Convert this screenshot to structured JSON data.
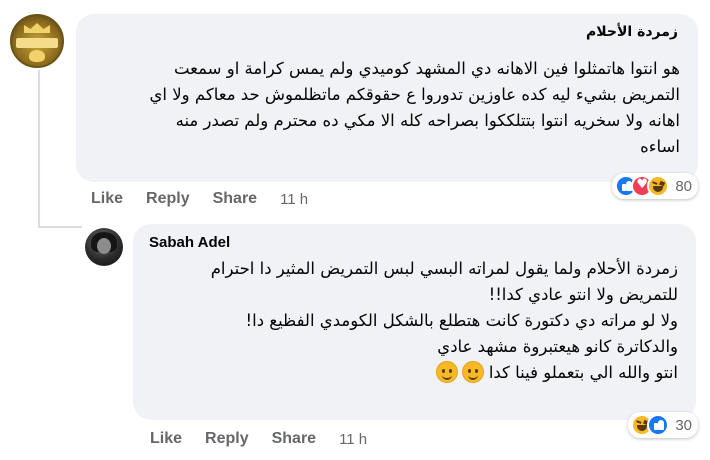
{
  "comments": [
    {
      "author": "زمردة الأحلام",
      "lines": [
        "هو انتوا هاتمثلوا فين الاهانه دي المشهد كوميدي ولم يمس كرامة او سمعت",
        "التمريض بشيء ليه كده عاوزين تدوروا ع حقوقكم ماتظلموش حد معاكم ولا اي",
        "اهانه ولا سخريه انتوا بتتلككوا بصراحه كله الا مكي ده محترم ولم تصدر منه",
        "اساءه"
      ],
      "reaction_icons": [
        "like-icon",
        "love-icon",
        "haha-icon"
      ],
      "reaction_count": "80",
      "actions": {
        "like": "Like",
        "reply": "Reply",
        "share": "Share"
      },
      "time": "11 h"
    },
    {
      "author": "Sabah Adel",
      "lines": [
        "زمردة الأحلام ولما يقول لمراته البسي لبس التمريض المثير دا احترام",
        "للتمريض ولا انتو عادي كدا!!",
        "ولا لو مراته دي دكتورة كانت هتطلع بالشكل الكومدي الفظيع دا!",
        "والدكاترة كانو هيعتبروة مشهد عادي",
        "انتو والله الي بتعملو فينا كدا"
      ],
      "emoji_icons": [
        "smiley-icon",
        "smiley-icon"
      ],
      "reaction_icons": [
        "haha-icon",
        "like-icon"
      ],
      "reaction_count": "30",
      "actions": {
        "like": "Like",
        "reply": "Reply",
        "share": "Share"
      },
      "time": "11 h"
    }
  ],
  "colors": {
    "bubble": "#f0f2f5",
    "secondary_text": "#65676b",
    "like_blue": "#1877f2",
    "love_red": "#f33e58",
    "haha_yellow": "#f7b928"
  }
}
